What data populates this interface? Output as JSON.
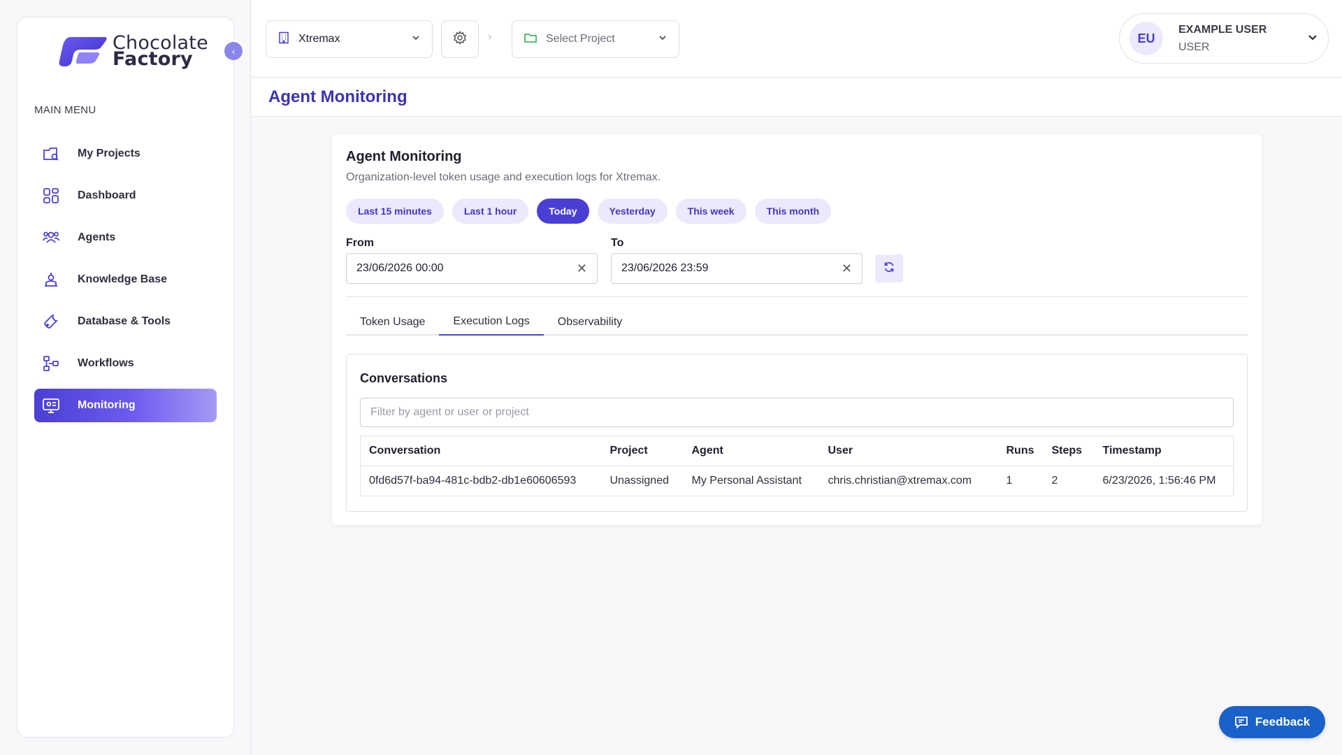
{
  "brand": {
    "line1": "Chocolate",
    "line2": "Factory"
  },
  "sidebar": {
    "heading": "MAIN MENU",
    "items": [
      {
        "label": "My Projects",
        "icon": "projects-icon"
      },
      {
        "label": "Dashboard",
        "icon": "dashboard-icon"
      },
      {
        "label": "Agents",
        "icon": "agents-icon"
      },
      {
        "label": "Knowledge Base",
        "icon": "knowledge-base-icon"
      },
      {
        "label": "Database & Tools",
        "icon": "wrench-icon"
      },
      {
        "label": "Workflows",
        "icon": "workflow-icon"
      },
      {
        "label": "Monitoring",
        "icon": "monitor-icon",
        "active": true
      }
    ]
  },
  "topbar": {
    "org": "Xtremax",
    "project_placeholder": "Select Project",
    "user": {
      "initials": "EU",
      "name": "EXAMPLE USER",
      "role": "USER"
    }
  },
  "page": {
    "title": "Agent Monitoring"
  },
  "card": {
    "title": "Agent Monitoring",
    "subtitle": "Organization-level token usage and execution logs for Xtremax.",
    "ranges": [
      "Last 15 minutes",
      "Last 1 hour",
      "Today",
      "Yesterday",
      "This week",
      "This month"
    ],
    "active_range": "Today",
    "from_label": "From",
    "from_value": "23/06/2026 00:00",
    "to_label": "To",
    "to_value": "23/06/2026 23:59",
    "tabs": [
      "Token Usage",
      "Execution Logs",
      "Observability"
    ],
    "active_tab": "Execution Logs"
  },
  "conversations": {
    "title": "Conversations",
    "filter_placeholder": "Filter by agent or user or project",
    "columns": [
      "Conversation",
      "Project",
      "Agent",
      "User",
      "Runs",
      "Steps",
      "Timestamp"
    ],
    "rows": [
      [
        "0fd6d57f-ba94-481c-bdb2-db1e60606593",
        "Unassigned",
        "My Personal Assistant",
        "chris.christian@xtremax.com",
        "1",
        "2",
        "6/23/2026, 1:56:46 PM"
      ]
    ]
  },
  "feedback": {
    "label": "Feedback"
  },
  "colors": {
    "accent": "#4a3fd4",
    "accent_light": "#ebe9fb",
    "title": "#3b33b5",
    "feedback": "#1a61c9"
  }
}
